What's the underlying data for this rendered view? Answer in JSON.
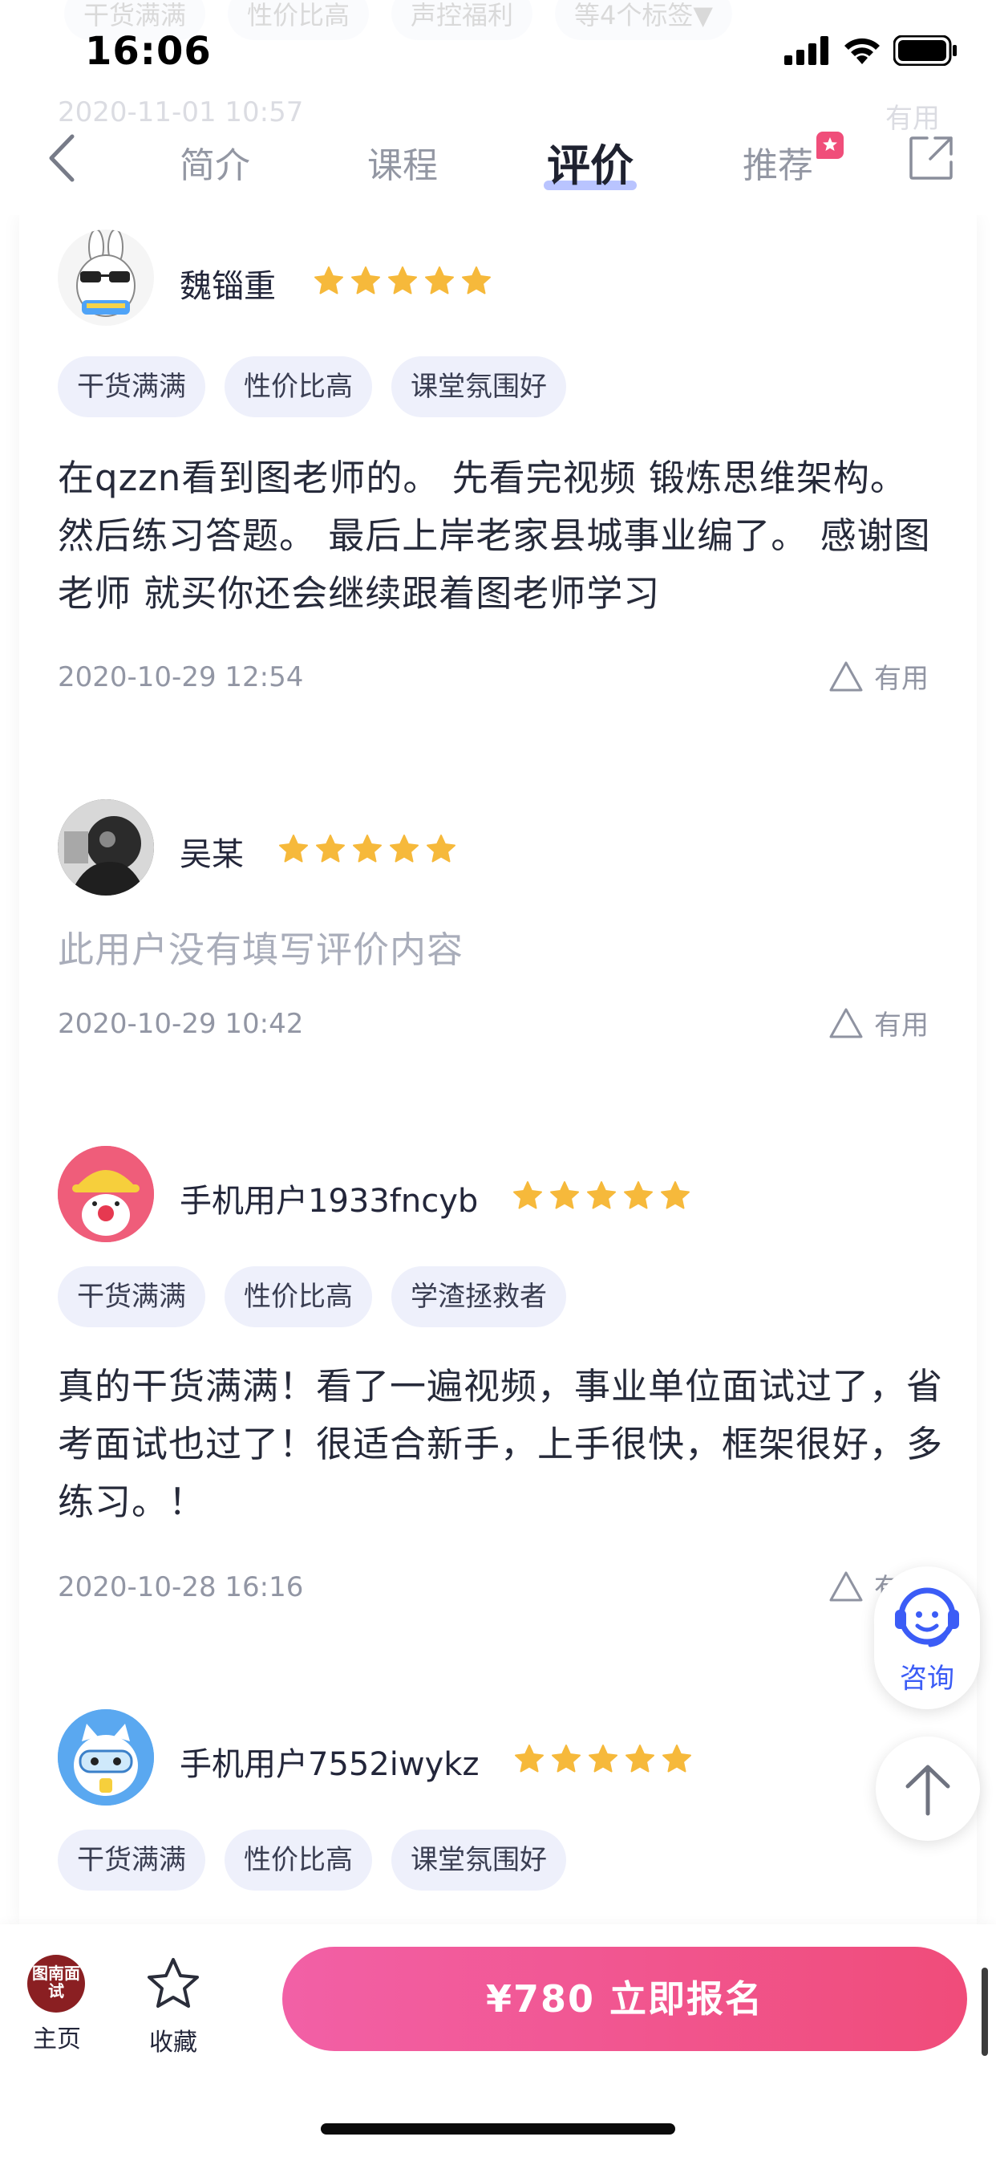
{
  "status_bar": {
    "time": "16:06",
    "icons": [
      "signal-icon",
      "wifi-icon",
      "battery-icon"
    ],
    "ghost_tags": [
      "干货满满",
      "性价比高",
      "声控福利",
      "等4个标签▼"
    ],
    "ghost_date": "2020-11-01 10:57",
    "ghost_useful": "有用"
  },
  "nav": {
    "tabs": [
      {
        "label": "简介",
        "active": false
      },
      {
        "label": "课程",
        "active": false
      },
      {
        "label": "评价",
        "active": true
      },
      {
        "label": "推荐",
        "active": false,
        "badge": "hot-badge-icon"
      }
    ],
    "accent_color": "#b9c4ff"
  },
  "reviews": [
    {
      "username": "魏锱重",
      "rating": 5,
      "tags": [
        "干货满满",
        "性价比高",
        "课堂氛围好"
      ],
      "text": "在qzzn看到图老师的。 先看完视频 锻炼思维架构。 然后练习答题。 最后上岸老家县城事业编了。 感谢图老师 就买你还会继续跟着图老师学习",
      "date": "2020-10-29 12:54",
      "useful_label": "有用"
    },
    {
      "username": "吴某",
      "rating": 5,
      "tags": [],
      "text": "此用户没有填写评价内容",
      "date": "2020-10-29 10:42",
      "useful_label": "有用"
    },
    {
      "username": "手机用户1933fncyb",
      "rating": 5,
      "tags": [
        "干货满满",
        "性价比高",
        "学渣拯救者"
      ],
      "text": "真的干货满满！看了一遍视频，事业单位面试过了，省考面试也过了！很适合新手，上手很快，框架很好，多练习。！",
      "date": "2020-10-28 16:16",
      "useful_label": "有用"
    },
    {
      "username": "手机用户7552iwykz",
      "rating": 5,
      "tags": [
        "干货满满",
        "性价比高",
        "课堂氛围好"
      ]
    }
  ],
  "floating": {
    "consult_label": "咨询"
  },
  "bottom_bar": {
    "home_logo_text": "图南面试",
    "home_label": "主页",
    "favorite_label": "收藏",
    "enroll_label": "¥780  立即报名",
    "enroll_colors": [
      "#f260a6",
      "#f04c7a"
    ]
  },
  "colors": {
    "star": "#f6b93b",
    "tag_bg": "#eef0fb",
    "consult": "#3b5cf6"
  }
}
